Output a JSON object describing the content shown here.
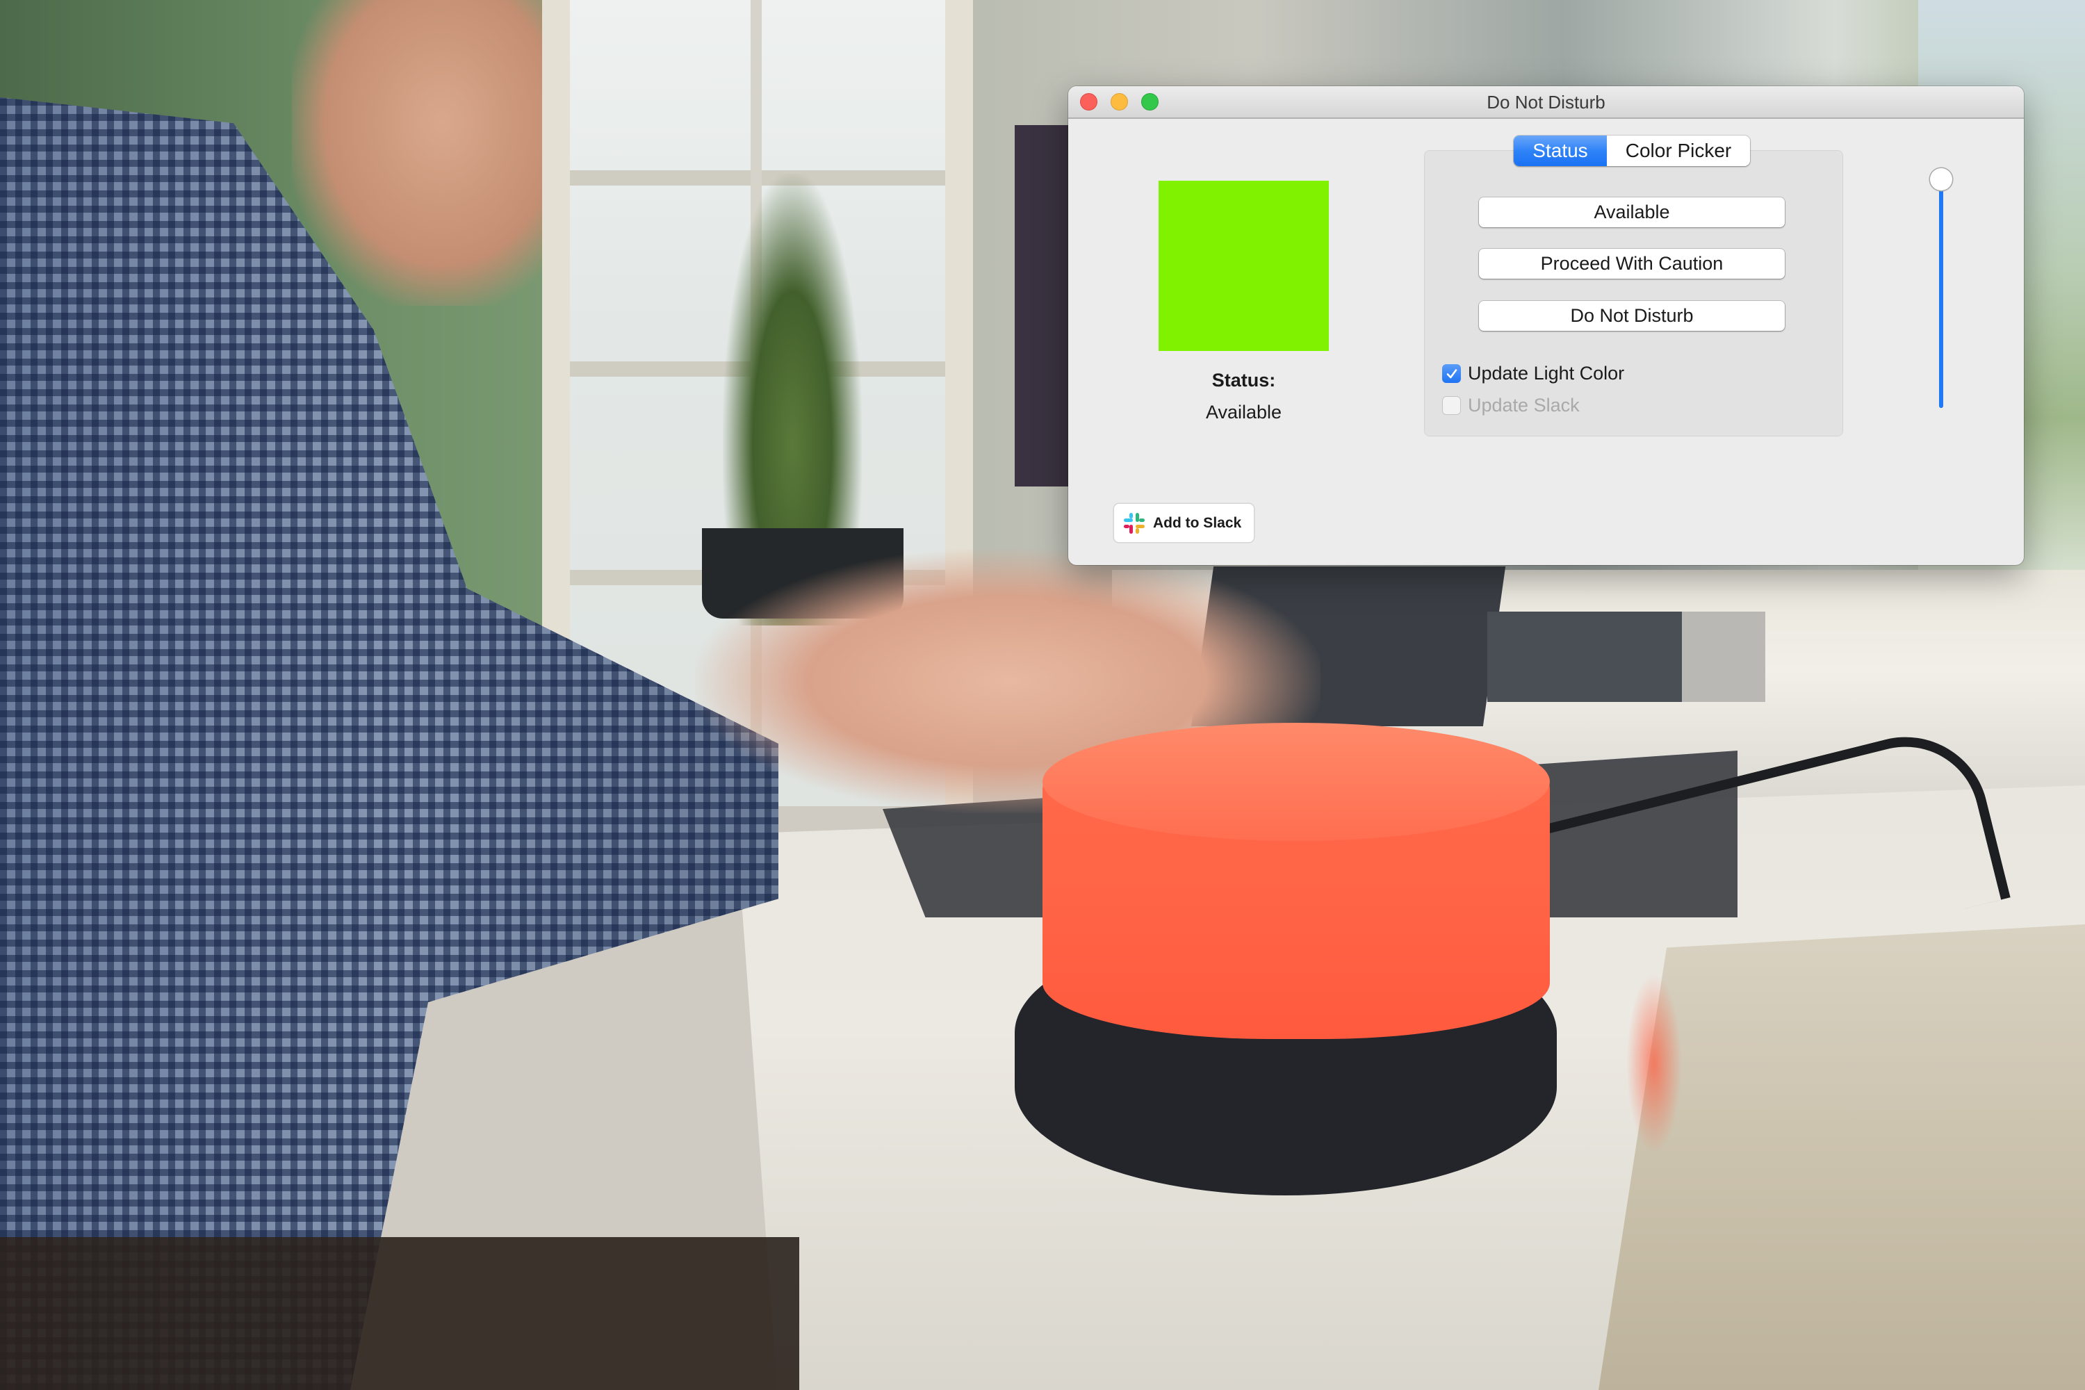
{
  "window": {
    "title": "Do Not Disturb",
    "controls": [
      "close",
      "minimize",
      "zoom"
    ]
  },
  "preview": {
    "swatch_color": "#80F200",
    "status_heading": "Status:",
    "status_value": "Available"
  },
  "tabs": [
    {
      "label": "Status",
      "selected": true
    },
    {
      "label": "Color Picker",
      "selected": false
    }
  ],
  "status_buttons": [
    {
      "label": "Available"
    },
    {
      "label": "Proceed With Caution"
    },
    {
      "label": "Do Not Disturb"
    }
  ],
  "options": [
    {
      "label": "Update Light Color",
      "checked": true,
      "enabled": true
    },
    {
      "label": "Update Slack",
      "checked": false,
      "enabled": false
    }
  ],
  "brightness_slider": {
    "value_percent": 100,
    "accent_color": "#1F78F5"
  },
  "slack_button": {
    "label": "Add to Slack",
    "icon": "slack-logo-icon"
  },
  "theme": {
    "accent": "#1F78F5",
    "window_bg": "#ECECEC",
    "lamp_color": "#FF6547"
  }
}
